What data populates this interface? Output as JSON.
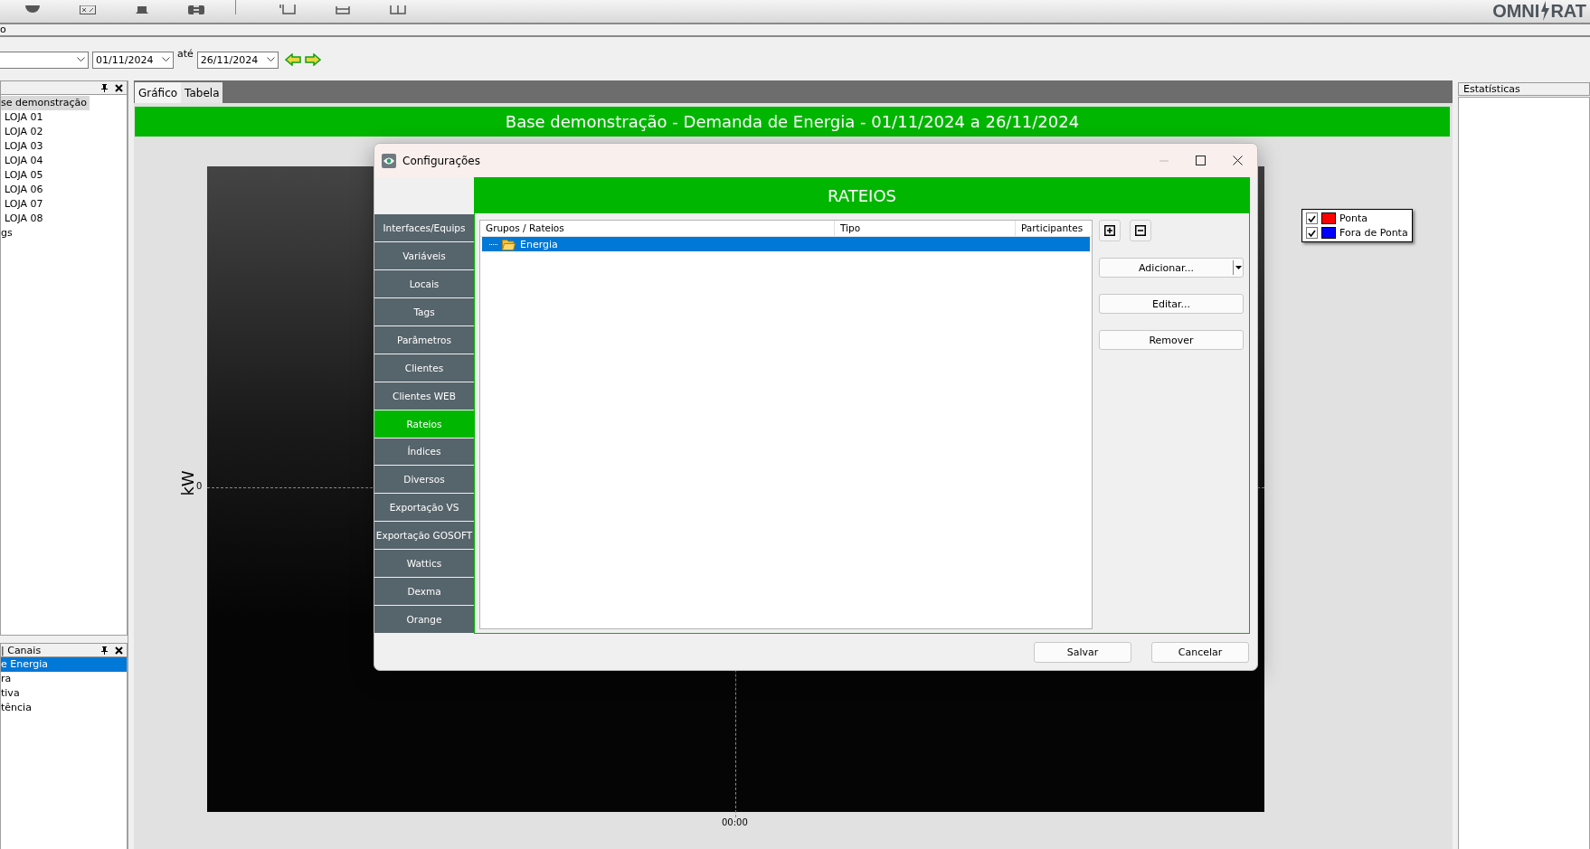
{
  "logo": {
    "left": "OMNI",
    "right": "RAT"
  },
  "menu": {
    "item": "o"
  },
  "filter": {
    "date_from": "01/11/2024",
    "separator": "até",
    "date_to": "26/11/2024"
  },
  "tree_panel": {
    "items": [
      {
        "label": "se demonstração",
        "selected": true,
        "children": [
          {
            "label": "LOJA 01",
            "selected": false
          },
          {
            "label": "LOJA 02",
            "selected": false
          },
          {
            "label": "LOJA 03",
            "selected": false
          },
          {
            "label": "LOJA 04",
            "selected": false
          },
          {
            "label": "LOJA 05",
            "selected": false
          },
          {
            "label": "LOJA 06",
            "selected": false
          },
          {
            "label": "LOJA 07",
            "selected": false
          },
          {
            "label": "LOJA 08",
            "selected": false
          }
        ]
      },
      {
        "label": "gs",
        "selected": false
      }
    ]
  },
  "channels_panel": {
    "title": "| Canais",
    "items": [
      {
        "label": "e Energia",
        "selected": true
      },
      {
        "label": "ra",
        "selected": false
      },
      {
        "label": "tiva",
        "selected": false
      },
      {
        "label": "tência",
        "selected": false
      }
    ]
  },
  "tabs": [
    {
      "label": "Gráfico",
      "selected": true
    },
    {
      "label": "Tabela",
      "selected": false
    }
  ],
  "chart": {
    "title": "Base demonstração - Demanda de Energia - 01/11/2024 a 26/11/2024",
    "ylabel": "kW",
    "ytick": "0",
    "xtick": "00:00",
    "legend": [
      {
        "label": "Ponta",
        "color": "#ff0000",
        "checked": true
      },
      {
        "label": "Fora de Ponta",
        "color": "#0000ff",
        "checked": true
      }
    ]
  },
  "stats_panel": {
    "title": "Estatísticas"
  },
  "dialog": {
    "title": "Configurações",
    "header": "RATEIOS",
    "nav": [
      {
        "label": "Interfaces/Equips",
        "selected": false
      },
      {
        "label": "Variáveis",
        "selected": false
      },
      {
        "label": "Locais",
        "selected": false
      },
      {
        "label": "Tags",
        "selected": false
      },
      {
        "label": "Parâmetros",
        "selected": false
      },
      {
        "label": "Clientes",
        "selected": false
      },
      {
        "label": "Clientes WEB",
        "selected": false
      },
      {
        "label": "Rateios",
        "selected": true
      },
      {
        "label": "Índices",
        "selected": false
      },
      {
        "label": "Diversos",
        "selected": false
      },
      {
        "label": "Exportação VS",
        "selected": false
      },
      {
        "label": "Exportação GOSOFT",
        "selected": false
      },
      {
        "label": "Wattics",
        "selected": false
      },
      {
        "label": "Dexma",
        "selected": false
      },
      {
        "label": "Orange",
        "selected": false
      }
    ],
    "columns": [
      "Grupos / Rateios",
      "Tipo",
      "Participantes"
    ],
    "rows": [
      {
        "label": "Energia",
        "selected": true
      }
    ],
    "actions": [
      "Adicionar...",
      "Editar...",
      "Remover"
    ],
    "buttons": [
      "Salvar",
      "Cancelar"
    ]
  }
}
